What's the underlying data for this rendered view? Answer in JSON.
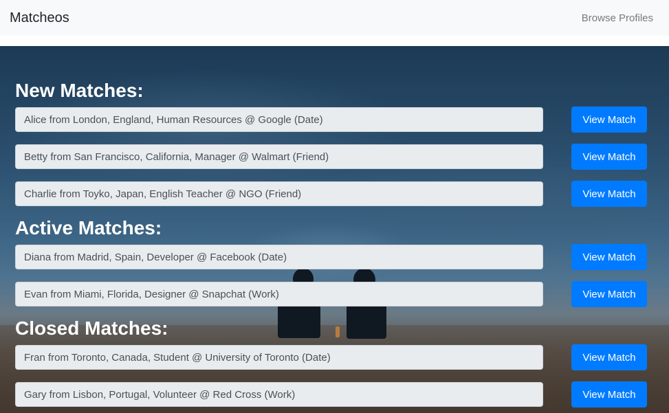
{
  "navbar": {
    "brand": "Matcheos",
    "browse_link": "Browse Profiles"
  },
  "sections": [
    {
      "heading": "New Matches:",
      "matches": [
        {
          "text": "Alice from London, England, Human Resources @ Google (Date)",
          "button": "View Match"
        },
        {
          "text": "Betty from San Francisco, California, Manager @ Walmart (Friend)",
          "button": "View Match"
        },
        {
          "text": "Charlie from Toyko, Japan, English Teacher @ NGO (Friend)",
          "button": "View Match"
        }
      ]
    },
    {
      "heading": "Active Matches:",
      "matches": [
        {
          "text": "Diana from Madrid, Spain, Developer @ Facebook (Date)",
          "button": "View Match"
        },
        {
          "text": "Evan from Miami, Florida, Designer @ Snapchat (Work)",
          "button": "View Match"
        }
      ]
    },
    {
      "heading": "Closed Matches:",
      "matches": [
        {
          "text": "Fran from Toronto, Canada, Student @ University of Toronto (Date)",
          "button": "View Match"
        },
        {
          "text": "Gary from Lisbon, Portugal, Volunteer @ Red Cross (Work)",
          "button": "View Match"
        }
      ]
    }
  ],
  "colors": {
    "primary_button": "#007bff",
    "navbar_bg": "#f8f9fa",
    "field_bg": "#e9ecef"
  }
}
